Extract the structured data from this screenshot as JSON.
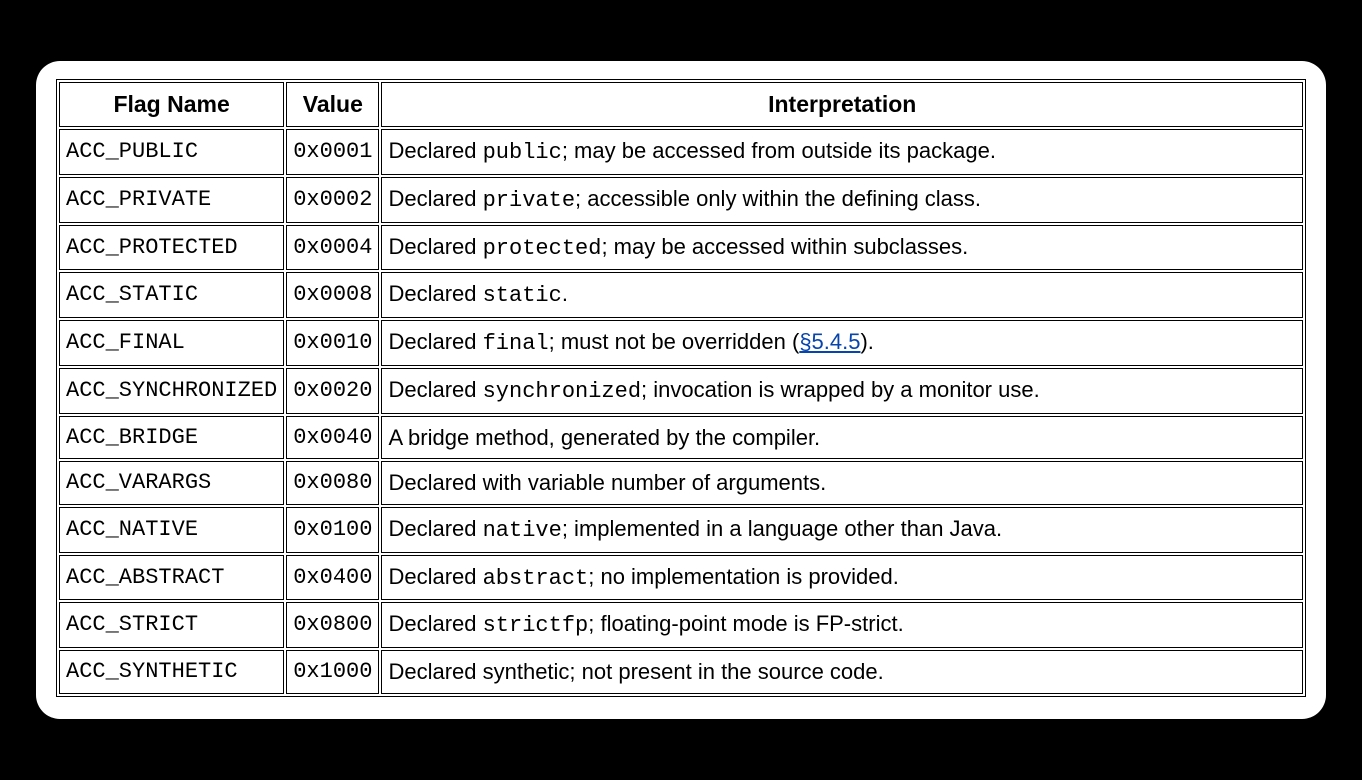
{
  "table": {
    "headers": {
      "flag": "Flag Name",
      "value": "Value",
      "interpretation": "Interpretation"
    },
    "rows": [
      {
        "flag": "ACC_PUBLIC",
        "value": "0x0001",
        "interp_pre": "Declared ",
        "interp_code": "public",
        "interp_post": "; may be accessed from outside its package."
      },
      {
        "flag": "ACC_PRIVATE",
        "value": "0x0002",
        "interp_pre": "Declared ",
        "interp_code": "private",
        "interp_post": "; accessible only within the defining class."
      },
      {
        "flag": "ACC_PROTECTED",
        "value": "0x0004",
        "interp_pre": "Declared ",
        "interp_code": "protected",
        "interp_post": "; may be accessed within subclasses."
      },
      {
        "flag": "ACC_STATIC",
        "value": "0x0008",
        "interp_pre": "Declared ",
        "interp_code": "static",
        "interp_post": "."
      },
      {
        "flag": "ACC_FINAL",
        "value": "0x0010",
        "interp_pre": "Declared ",
        "interp_code": "final",
        "interp_post_a": "; must not be overridden (",
        "link_text": "§5.4.5",
        "interp_post_b": ")."
      },
      {
        "flag": "ACC_SYNCHRONIZED",
        "value": "0x0020",
        "interp_pre": "Declared ",
        "interp_code": "synchronized",
        "interp_post": "; invocation is wrapped by a monitor use."
      },
      {
        "flag": "ACC_BRIDGE",
        "value": "0x0040",
        "interp_plain": "A bridge method, generated by the compiler."
      },
      {
        "flag": "ACC_VARARGS",
        "value": "0x0080",
        "interp_plain": "Declared with variable number of arguments."
      },
      {
        "flag": "ACC_NATIVE",
        "value": "0x0100",
        "interp_pre": "Declared ",
        "interp_code": "native",
        "interp_post": "; implemented in a language other than Java."
      },
      {
        "flag": "ACC_ABSTRACT",
        "value": "0x0400",
        "interp_pre": "Declared ",
        "interp_code": "abstract",
        "interp_post": "; no implementation is provided."
      },
      {
        "flag": "ACC_STRICT",
        "value": "0x0800",
        "interp_pre": "Declared ",
        "interp_code": "strictfp",
        "interp_post": "; floating-point mode is FP-strict."
      },
      {
        "flag": "ACC_SYNTHETIC",
        "value": "0x1000",
        "interp_plain": "Declared synthetic; not present in the source code."
      }
    ]
  }
}
